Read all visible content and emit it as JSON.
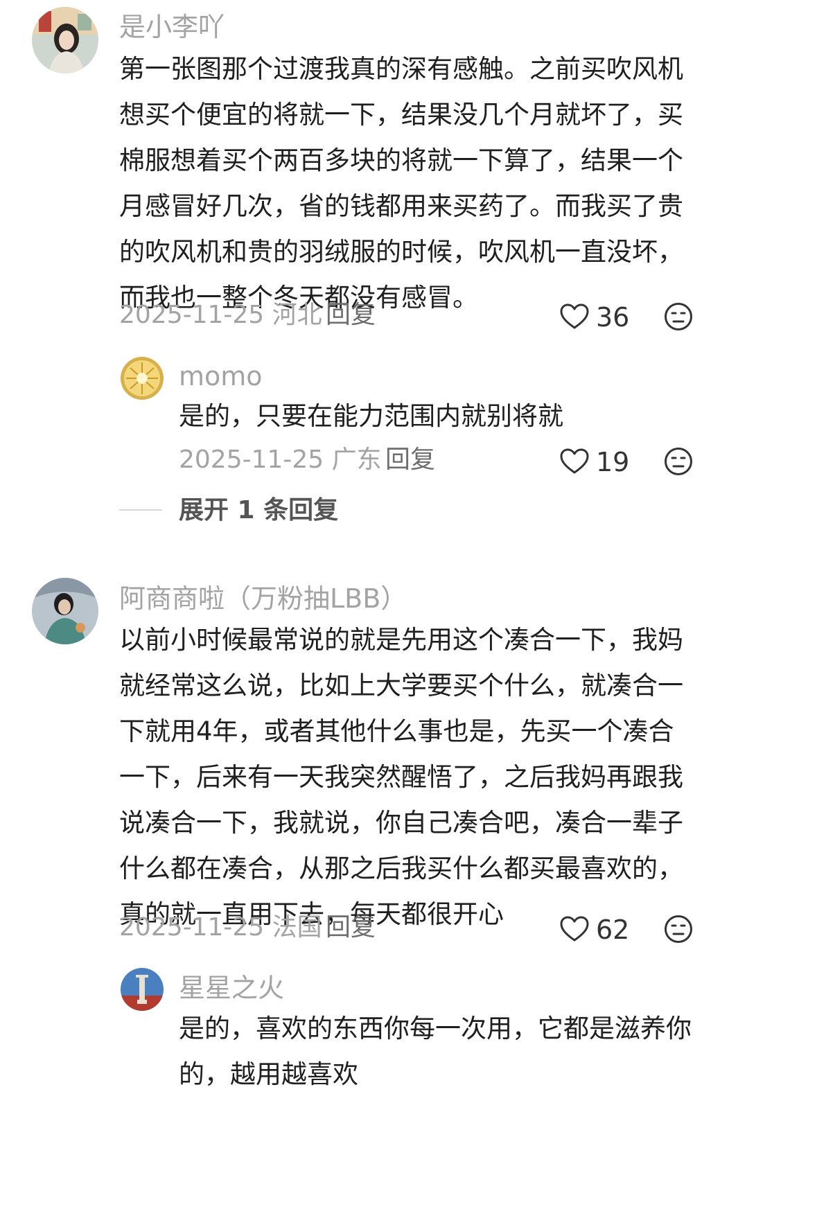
{
  "comments": [
    {
      "username": "是小李吖",
      "lines": [
        "第一张图那个过渡我真的深有感触。之前买吹风机",
        "想买个便宜的将就一下，结果没几个月就坏了，买",
        "棉服想着买个两百多块的将就一下算了，结果一个",
        "月感冒好几次，省的钱都用来买药了。而我买了贵",
        "的吹风机和贵的羽绒服的时候，吹风机一直没坏，",
        "而我也一整个冬天都没有感冒。"
      ],
      "meta": "2025-11-25 河北",
      "reply_label": "回复",
      "likes": "36",
      "replies": [
        {
          "username": "momo",
          "lines": [
            "是的，只要在能力范围内就别将就"
          ],
          "meta": "2025-11-25 广东",
          "reply_label": "回复",
          "likes": "19"
        }
      ],
      "expand_label": "展开 1 条回复"
    },
    {
      "username": "阿商商啦（万粉抽LBB）",
      "lines": [
        "以前小时候最常说的就是先用这个凑合一下，我妈",
        "就经常这么说，比如上大学要买个什么，就凑合一",
        "下就用4年，或者其他什么事也是，先买一个凑合",
        "一下，后来有一天我突然醒悟了，之后我妈再跟我",
        "说凑合一下，我就说，你自己凑合吧，凑合一辈子",
        "什么都在凑合，从那之后我买什么都买最喜欢的，",
        "真的就一直用下去，每天都很开心"
      ],
      "meta": "2025-11-25 法国",
      "reply_label": "回复",
      "likes": "62",
      "replies": [
        {
          "username": "星星之火",
          "lines": [
            "是的，喜欢的东西你每一次用，它都是滋养你",
            "的，越用越喜欢"
          ]
        }
      ]
    }
  ],
  "icons": {
    "like": "heart-outline-icon",
    "dislike": "neutral-face-icon"
  },
  "colors": {
    "text": "#1f1f1f",
    "muted": "#a3a3a3",
    "background": "#ffffff"
  }
}
